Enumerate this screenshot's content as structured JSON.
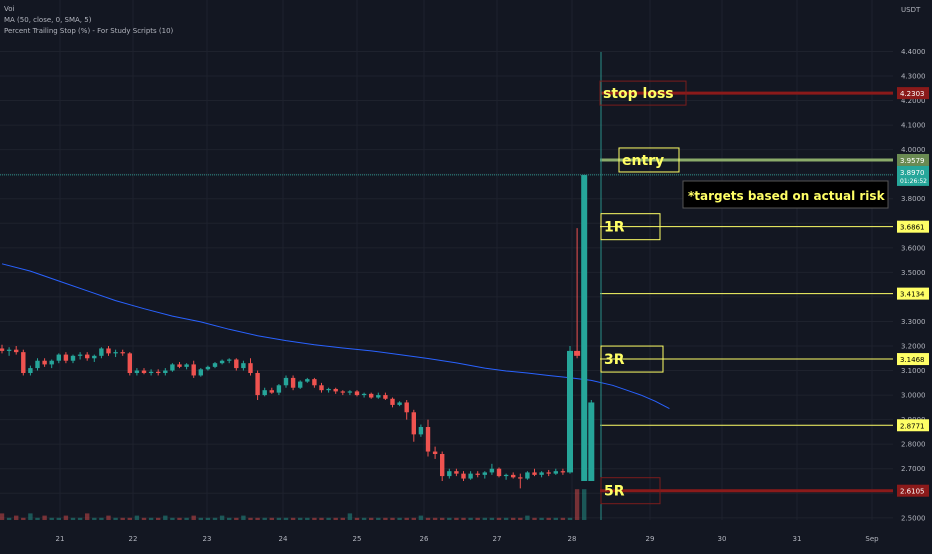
{
  "legend": {
    "symbol": "Voi",
    "ma": "MA (50, close, 0, SMA, 5)",
    "strategy": "Percent Trailing Stop (%) - For Study Scripts (10)"
  },
  "currency": "USDT",
  "colors": {
    "background": "#131722",
    "grid": "#1e222d",
    "up": "#26a69a",
    "down": "#ef5350",
    "ma": "#2962ff",
    "target": "#ffff66",
    "stop": "#8b1a1a",
    "entry": "#8bab6a",
    "axis_text": "#b2b5be"
  },
  "chart_data": {
    "type": "candlestick",
    "ylim": [
      2.43,
      4.52
    ],
    "x_ticks": [
      "21",
      "22",
      "23",
      "24",
      "25",
      "26",
      "27",
      "28",
      "29",
      "30",
      "31",
      "Sep"
    ],
    "y_ticks": [
      "4.4000",
      "4.3000",
      "4.2000",
      "4.1000",
      "4.0000",
      "3.9000",
      "3.8000",
      "3.7000",
      "3.6000",
      "3.5000",
      "3.4000",
      "3.3000",
      "3.2000",
      "3.1000",
      "3.0000",
      "2.9000",
      "2.8000",
      "2.7000",
      "2.6000",
      "2.5000"
    ],
    "candles": [
      {
        "o": 3.19,
        "h": 3.205,
        "l": 3.17,
        "c": 3.18
      },
      {
        "o": 3.18,
        "h": 3.195,
        "l": 3.16,
        "c": 3.185
      },
      {
        "o": 3.185,
        "h": 3.2,
        "l": 3.165,
        "c": 3.175
      },
      {
        "o": 3.175,
        "h": 3.185,
        "l": 3.08,
        "c": 3.09
      },
      {
        "o": 3.09,
        "h": 3.12,
        "l": 3.08,
        "c": 3.11
      },
      {
        "o": 3.11,
        "h": 3.15,
        "l": 3.1,
        "c": 3.14
      },
      {
        "o": 3.14,
        "h": 3.15,
        "l": 3.115,
        "c": 3.125
      },
      {
        "o": 3.125,
        "h": 3.145,
        "l": 3.11,
        "c": 3.14
      },
      {
        "o": 3.14,
        "h": 3.17,
        "l": 3.13,
        "c": 3.165
      },
      {
        "o": 3.165,
        "h": 3.175,
        "l": 3.13,
        "c": 3.14
      },
      {
        "o": 3.14,
        "h": 3.165,
        "l": 3.13,
        "c": 3.16
      },
      {
        "o": 3.16,
        "h": 3.175,
        "l": 3.145,
        "c": 3.165
      },
      {
        "o": 3.165,
        "h": 3.175,
        "l": 3.14,
        "c": 3.15
      },
      {
        "o": 3.15,
        "h": 3.165,
        "l": 3.135,
        "c": 3.16
      },
      {
        "o": 3.16,
        "h": 3.195,
        "l": 3.15,
        "c": 3.19
      },
      {
        "o": 3.19,
        "h": 3.2,
        "l": 3.16,
        "c": 3.17
      },
      {
        "o": 3.17,
        "h": 3.185,
        "l": 3.155,
        "c": 3.175
      },
      {
        "o": 3.175,
        "h": 3.185,
        "l": 3.16,
        "c": 3.17
      },
      {
        "o": 3.17,
        "h": 3.175,
        "l": 3.08,
        "c": 3.09
      },
      {
        "o": 3.09,
        "h": 3.11,
        "l": 3.08,
        "c": 3.1
      },
      {
        "o": 3.1,
        "h": 3.11,
        "l": 3.085,
        "c": 3.09
      },
      {
        "o": 3.09,
        "h": 3.105,
        "l": 3.08,
        "c": 3.095
      },
      {
        "o": 3.095,
        "h": 3.105,
        "l": 3.08,
        "c": 3.09
      },
      {
        "o": 3.09,
        "h": 3.11,
        "l": 3.08,
        "c": 3.1
      },
      {
        "o": 3.1,
        "h": 3.13,
        "l": 3.095,
        "c": 3.125
      },
      {
        "o": 3.125,
        "h": 3.135,
        "l": 3.11,
        "c": 3.115
      },
      {
        "o": 3.115,
        "h": 3.13,
        "l": 3.105,
        "c": 3.125
      },
      {
        "o": 3.125,
        "h": 3.14,
        "l": 3.07,
        "c": 3.08
      },
      {
        "o": 3.08,
        "h": 3.11,
        "l": 3.075,
        "c": 3.105
      },
      {
        "o": 3.105,
        "h": 3.12,
        "l": 3.1,
        "c": 3.115
      },
      {
        "o": 3.115,
        "h": 3.135,
        "l": 3.11,
        "c": 3.13
      },
      {
        "o": 3.13,
        "h": 3.145,
        "l": 3.125,
        "c": 3.14
      },
      {
        "o": 3.14,
        "h": 3.15,
        "l": 3.13,
        "c": 3.145
      },
      {
        "o": 3.145,
        "h": 3.15,
        "l": 3.1,
        "c": 3.11
      },
      {
        "o": 3.11,
        "h": 3.14,
        "l": 3.1,
        "c": 3.13
      },
      {
        "o": 3.13,
        "h": 3.15,
        "l": 3.08,
        "c": 3.09
      },
      {
        "o": 3.09,
        "h": 3.1,
        "l": 2.98,
        "c": 3.0
      },
      {
        "o": 3.0,
        "h": 3.03,
        "l": 2.995,
        "c": 3.02
      },
      {
        "o": 3.02,
        "h": 3.03,
        "l": 3.005,
        "c": 3.01
      },
      {
        "o": 3.01,
        "h": 3.045,
        "l": 3.0,
        "c": 3.04
      },
      {
        "o": 3.04,
        "h": 3.08,
        "l": 3.03,
        "c": 3.07
      },
      {
        "o": 3.07,
        "h": 3.08,
        "l": 3.02,
        "c": 3.03
      },
      {
        "o": 3.03,
        "h": 3.06,
        "l": 3.025,
        "c": 3.055
      },
      {
        "o": 3.055,
        "h": 3.07,
        "l": 3.05,
        "c": 3.065
      },
      {
        "o": 3.065,
        "h": 3.07,
        "l": 3.03,
        "c": 3.04
      },
      {
        "o": 3.04,
        "h": 3.05,
        "l": 3.01,
        "c": 3.02
      },
      {
        "o": 3.02,
        "h": 3.03,
        "l": 3.01,
        "c": 3.025
      },
      {
        "o": 3.025,
        "h": 3.03,
        "l": 3.005,
        "c": 3.015
      },
      {
        "o": 3.015,
        "h": 3.02,
        "l": 3.0,
        "c": 3.01
      },
      {
        "o": 3.01,
        "h": 3.02,
        "l": 3.0,
        "c": 3.015
      },
      {
        "o": 3.015,
        "h": 3.02,
        "l": 2.995,
        "c": 3.0
      },
      {
        "o": 3.0,
        "h": 3.01,
        "l": 2.99,
        "c": 3.005
      },
      {
        "o": 3.005,
        "h": 3.01,
        "l": 2.985,
        "c": 2.99
      },
      {
        "o": 2.99,
        "h": 3.01,
        "l": 2.985,
        "c": 3.0
      },
      {
        "o": 3.0,
        "h": 3.01,
        "l": 2.98,
        "c": 2.985
      },
      {
        "o": 2.985,
        "h": 2.99,
        "l": 2.95,
        "c": 2.96
      },
      {
        "o": 2.96,
        "h": 2.975,
        "l": 2.955,
        "c": 2.97
      },
      {
        "o": 2.97,
        "h": 2.98,
        "l": 2.9,
        "c": 2.93
      },
      {
        "o": 2.93,
        "h": 2.94,
        "l": 2.81,
        "c": 2.84
      },
      {
        "o": 2.84,
        "h": 2.88,
        "l": 2.83,
        "c": 2.87
      },
      {
        "o": 2.87,
        "h": 2.9,
        "l": 2.75,
        "c": 2.77
      },
      {
        "o": 2.77,
        "h": 2.79,
        "l": 2.74,
        "c": 2.76
      },
      {
        "o": 2.76,
        "h": 2.77,
        "l": 2.65,
        "c": 2.67
      },
      {
        "o": 2.67,
        "h": 2.7,
        "l": 2.66,
        "c": 2.69
      },
      {
        "o": 2.69,
        "h": 2.7,
        "l": 2.67,
        "c": 2.68
      },
      {
        "o": 2.68,
        "h": 2.69,
        "l": 2.65,
        "c": 2.66
      },
      {
        "o": 2.66,
        "h": 2.69,
        "l": 2.655,
        "c": 2.68
      },
      {
        "o": 2.68,
        "h": 2.69,
        "l": 2.665,
        "c": 2.675
      },
      {
        "o": 2.675,
        "h": 2.69,
        "l": 2.66,
        "c": 2.685
      },
      {
        "o": 2.685,
        "h": 2.72,
        "l": 2.675,
        "c": 2.7
      },
      {
        "o": 2.7,
        "h": 2.705,
        "l": 2.665,
        "c": 2.67
      },
      {
        "o": 2.67,
        "h": 2.68,
        "l": 2.655,
        "c": 2.675
      },
      {
        "o": 2.675,
        "h": 2.685,
        "l": 2.66,
        "c": 2.665
      },
      {
        "o": 2.665,
        "h": 2.68,
        "l": 2.62,
        "c": 2.66
      },
      {
        "o": 2.66,
        "h": 2.69,
        "l": 2.655,
        "c": 2.685
      },
      {
        "o": 2.685,
        "h": 2.7,
        "l": 2.67,
        "c": 2.675
      },
      {
        "o": 2.675,
        "h": 2.69,
        "l": 2.665,
        "c": 2.685
      },
      {
        "o": 2.685,
        "h": 2.695,
        "l": 2.67,
        "c": 2.68
      },
      {
        "o": 2.68,
        "h": 2.7,
        "l": 2.675,
        "c": 2.69
      },
      {
        "o": 2.69,
        "h": 2.7,
        "l": 2.675,
        "c": 2.685
      },
      {
        "o": 2.685,
        "h": 3.2,
        "l": 2.68,
        "c": 3.18
      },
      {
        "o": 3.18,
        "h": 3.68,
        "l": 3.15,
        "c": 3.16
      },
      {
        "o": 2.65,
        "h": 3.897,
        "l": 2.65,
        "c": 3.897
      },
      {
        "o": 2.65,
        "h": 2.98,
        "l": 2.65,
        "c": 2.97
      }
    ],
    "ma_points": [
      [
        0,
        3.535
      ],
      [
        4,
        3.505
      ],
      [
        8,
        3.465
      ],
      [
        12,
        3.425
      ],
      [
        16,
        3.385
      ],
      [
        20,
        3.352
      ],
      [
        24,
        3.322
      ],
      [
        28,
        3.298
      ],
      [
        32,
        3.268
      ],
      [
        36,
        3.242
      ],
      [
        40,
        3.222
      ],
      [
        44,
        3.205
      ],
      [
        48,
        3.192
      ],
      [
        52,
        3.18
      ],
      [
        56,
        3.165
      ],
      [
        60,
        3.149
      ],
      [
        64,
        3.131
      ],
      [
        68,
        3.11
      ],
      [
        71,
        3.098
      ],
      [
        74,
        3.09
      ],
      [
        77,
        3.08
      ],
      [
        80,
        3.071
      ],
      [
        83,
        3.06
      ],
      [
        86,
        3.04
      ],
      [
        88,
        3.02
      ],
      [
        90,
        3.0
      ],
      [
        92,
        2.975
      ],
      [
        94,
        2.945
      ]
    ],
    "levels": [
      {
        "name": "stop",
        "value": 4.2303,
        "label": "4.2303",
        "tag": "stop loss",
        "tag_box": {
          "kind": "stop"
        }
      },
      {
        "name": "entry",
        "value": 3.9579,
        "label": "3.9579",
        "tag": "entry",
        "tag_box": {
          "kind": "entry"
        }
      },
      {
        "name": "1r",
        "value": 3.6861,
        "label": "3.6861",
        "tag": "1R",
        "tag_box": {
          "kind": "target"
        }
      },
      {
        "name": "2r",
        "value": 3.4134,
        "label": "3.4134",
        "tag": "",
        "tag_box": null
      },
      {
        "name": "3r",
        "value": 3.1468,
        "label": "3.1468",
        "tag": "3R",
        "tag_box": {
          "kind": "target"
        }
      },
      {
        "name": "4r",
        "value": 2.8771,
        "label": "2.8771",
        "tag": "",
        "tag_box": null
      },
      {
        "name": "5r",
        "value": 2.6105,
        "label": "2.6105",
        "tag": "5R",
        "tag_box": {
          "kind": "stop"
        }
      }
    ],
    "current_price": {
      "value": 3.897,
      "label": "3.8970",
      "countdown": "01:26:52"
    },
    "note": "*targets based on actual risk",
    "volume": [
      3,
      1,
      2,
      1,
      3,
      1,
      2,
      1,
      1,
      2,
      1,
      1,
      3,
      1,
      1,
      2,
      1,
      1,
      1,
      2,
      1,
      1,
      1,
      2,
      1,
      1,
      1,
      2,
      1,
      1,
      1,
      2,
      1,
      1,
      2,
      1,
      1,
      1,
      1,
      1,
      1,
      1,
      1,
      1,
      1,
      1,
      1,
      1,
      1,
      3,
      1,
      1,
      1,
      1,
      1,
      1,
      1,
      1,
      1,
      2,
      1,
      1,
      1,
      1,
      1,
      1,
      1,
      1,
      1,
      1,
      1,
      1,
      1,
      1,
      2,
      1,
      1,
      1,
      1,
      1,
      1,
      14,
      14
    ]
  }
}
